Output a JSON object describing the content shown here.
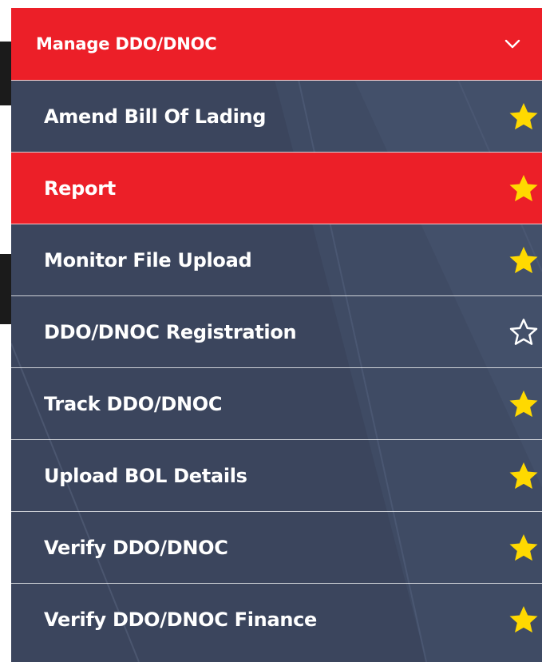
{
  "menu": {
    "header": {
      "title": "Manage DDO/DNOC",
      "expand_icon": "chevron-down-icon"
    },
    "items": [
      {
        "label": "Amend Bill Of Lading",
        "favorite": true,
        "active": false
      },
      {
        "label": "Report",
        "favorite": true,
        "active": true
      },
      {
        "label": "Monitor File Upload",
        "favorite": true,
        "active": false
      },
      {
        "label": "DDO/DNOC Registration",
        "favorite": false,
        "active": false
      },
      {
        "label": "Track DDO/DNOC",
        "favorite": true,
        "active": false
      },
      {
        "label": "Upload BOL Details",
        "favorite": true,
        "active": false
      },
      {
        "label": "Verify DDO/DNOC",
        "favorite": true,
        "active": false
      },
      {
        "label": "Verify DDO/DNOC Finance",
        "favorite": true,
        "active": false
      }
    ]
  },
  "colors": {
    "menu_background": "#3b455d",
    "accent_red": "#ec1f28",
    "star_filled": "#ffd900",
    "text": "#ffffff"
  },
  "icons": {
    "favorite_on": "star-filled-icon",
    "favorite_off": "star-outline-icon"
  }
}
